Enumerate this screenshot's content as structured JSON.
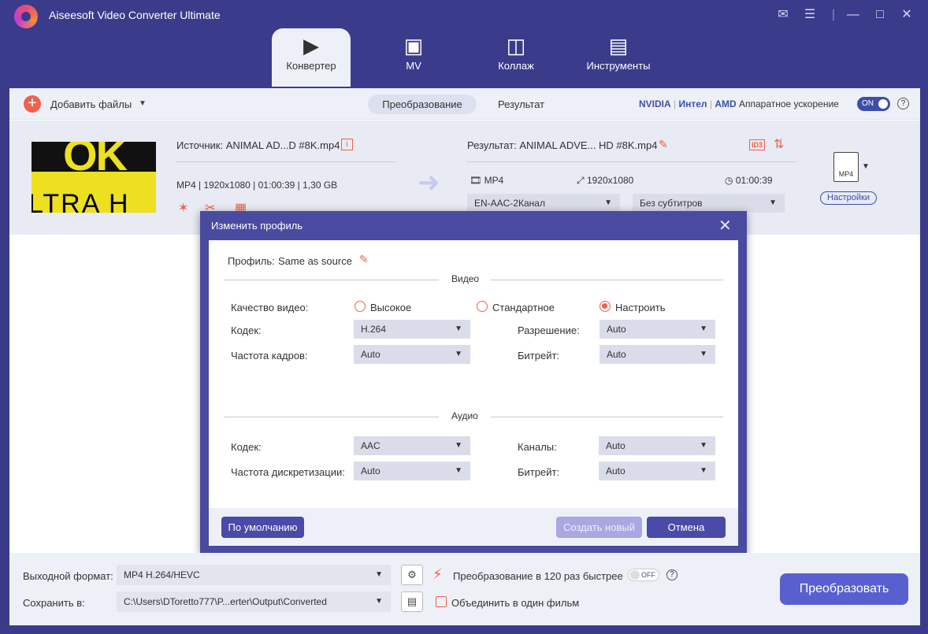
{
  "app": {
    "title": "Aiseesoft Video Converter Ultimate"
  },
  "tabs": [
    {
      "label": "Конвертер",
      "icon": "converter-icon"
    },
    {
      "label": "MV",
      "icon": "tv-icon"
    },
    {
      "label": "Коллаж",
      "icon": "collage-icon"
    },
    {
      "label": "Инструменты",
      "icon": "toolbox-icon"
    }
  ],
  "toolbar": {
    "add_files": "Добавить файлы",
    "tab_convert": "Преобразование",
    "tab_result": "Результат",
    "nvidia": "NVIDIA",
    "intel": "Интел",
    "amd": "AMD",
    "hw_accel": "Аппаратное ускорение",
    "toggle": "ON"
  },
  "file": {
    "source": "Источник: ANIMAL AD...D #8K.mp4",
    "meta": "MP4 | 1920x1080 | 01:00:39 | 1,30 GB",
    "result": "Результат: ANIMAL ADVE... HD #8K.mp4",
    "result_format": "MP4",
    "result_res": "1920x1080",
    "result_duration": "01:00:39",
    "audio_track": "EN-AAC-2Канал",
    "subtitles": "Без субтитров",
    "format_badge": "MP4",
    "settings": "Настройки"
  },
  "dialog": {
    "title": "Изменить профиль",
    "profile_label": "Профиль:",
    "profile_value": "Same as source",
    "video_section": "Видео",
    "quality_label": "Качество видео:",
    "quality_options": [
      "Высокое",
      "Стандартное",
      "Настроить"
    ],
    "quality_selected": "Настроить",
    "v_codec_label": "Кодек:",
    "v_codec": "H.264",
    "resolution_label": "Разрешение:",
    "resolution": "Auto",
    "framerate_label": "Частота кадров:",
    "framerate": "Auto",
    "v_bitrate_label": "Битрейт:",
    "v_bitrate": "Auto",
    "audio_section": "Аудио",
    "a_codec_label": "Кодек:",
    "a_codec": "AAC",
    "channels_label": "Каналы:",
    "channels": "Auto",
    "samplerate_label": "Частота дискретизации:",
    "samplerate": "Auto",
    "a_bitrate_label": "Битрейт:",
    "a_bitrate": "Auto",
    "default_btn": "По умолчанию",
    "create_btn": "Создать новый",
    "cancel_btn": "Отмена"
  },
  "bottom": {
    "output_label": "Выходной формат:",
    "output_value": "MP4 H.264/HEVC",
    "save_label": "Сохранить в:",
    "save_value": "C:\\Users\\DToretto777\\P...erter\\Output\\Converted",
    "speed_text": "Преобразование в 120 раз быстрее",
    "speed_toggle": "OFF",
    "merge_text": "Объединить в один фильм",
    "convert_btn": "Преобразовать"
  },
  "colors": {
    "accent": "#f0604a",
    "brand": "#3b3b8c",
    "primary": "#5a5fd0"
  }
}
